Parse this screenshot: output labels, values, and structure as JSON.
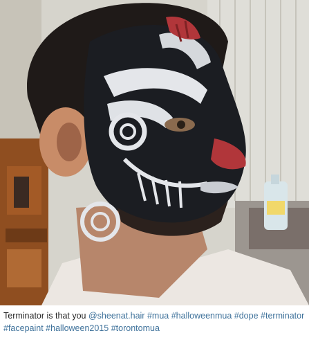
{
  "post": {
    "image": {
      "subject_icon": "face-paint-photo",
      "colors": {
        "bg_blinds": "#d9d8d2",
        "skin": "#c98f6c",
        "paint_dark": "#1b1d22",
        "paint_light": "#e4e6ea",
        "blood": "#b1363a",
        "shelf": "#a35a26",
        "bottle": "#d9e6ea"
      }
    },
    "caption": {
      "text": "Terminator is that you",
      "tags": [
        {
          "label": "@sheenat.hair"
        },
        {
          "label": "#mua"
        },
        {
          "label": "#halloweenmua"
        },
        {
          "label": "#dope"
        },
        {
          "label": "#terminator"
        },
        {
          "label": "#facepaint"
        },
        {
          "label": "#halloween2015"
        },
        {
          "label": "#torontomua"
        }
      ]
    }
  }
}
